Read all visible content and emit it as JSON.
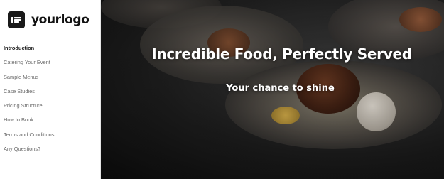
{
  "logo": {
    "text": "yourlogo",
    "icon": "logo-mark-icon"
  },
  "nav": {
    "items": [
      {
        "label": "Introduction",
        "active": true
      },
      {
        "label": "Catering Your Event",
        "active": false
      },
      {
        "label": "Sample Menus",
        "active": false
      },
      {
        "label": "Case Studies",
        "active": false
      },
      {
        "label": "Pricing Structure",
        "active": false
      },
      {
        "label": "How to Book",
        "active": false
      },
      {
        "label": "Terms and Conditions",
        "active": false
      },
      {
        "label": "Any Questions?",
        "active": false
      }
    ]
  },
  "hero": {
    "title": "Incredible Food, Perfectly Served",
    "subtitle": "Your chance to shine"
  },
  "colors": {
    "sidebar_bg": "#ffffff",
    "nav_active": "#1a1a1a",
    "nav_inactive": "#6b6b6b",
    "hero_text": "#ffffff"
  }
}
